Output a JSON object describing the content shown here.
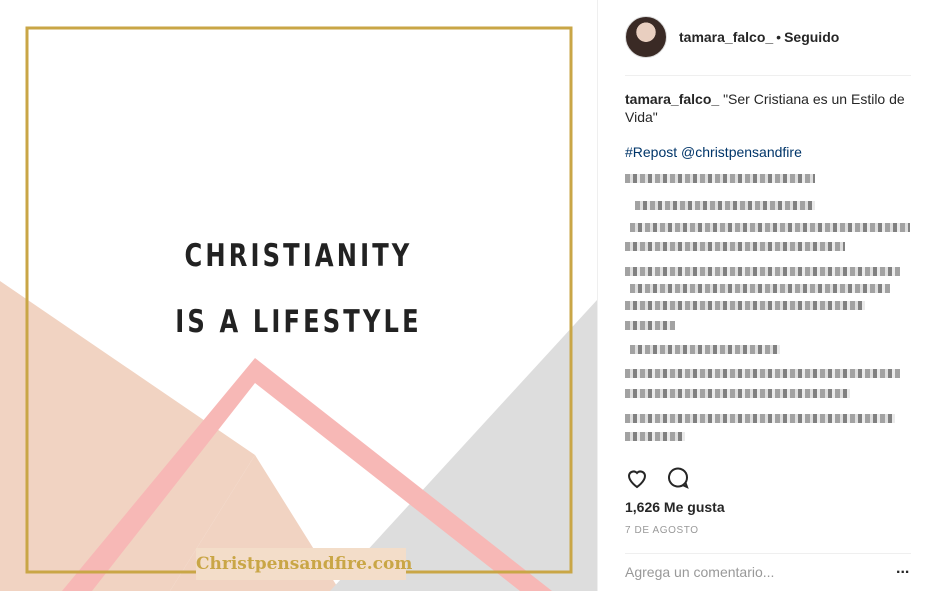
{
  "image": {
    "line1": "CHRISTIANITY",
    "line2": "IS A LIFESTYLE",
    "watermark": "Christpensandfire.com"
  },
  "header": {
    "username": "tamara_falco_",
    "separator": "•",
    "status": "Seguido"
  },
  "caption": {
    "username": "tamara_falco_",
    "text": "\"Ser Cristiana es un Estilo de Vida\"",
    "repost": "#Repost @christpensandfire"
  },
  "actions": {
    "heart": "heart-icon",
    "comment": "comment-icon"
  },
  "likes": "1,626 Me gusta",
  "date": "7 DE AGOSTO",
  "comment_input": {
    "placeholder": "Agrega un comentario..."
  },
  "more": "...",
  "colors": {
    "peach": "#f1d3c2",
    "gray": "#dddddd",
    "pink": "#f7b8b6",
    "gold": "#c9a646",
    "link": "#003569"
  }
}
